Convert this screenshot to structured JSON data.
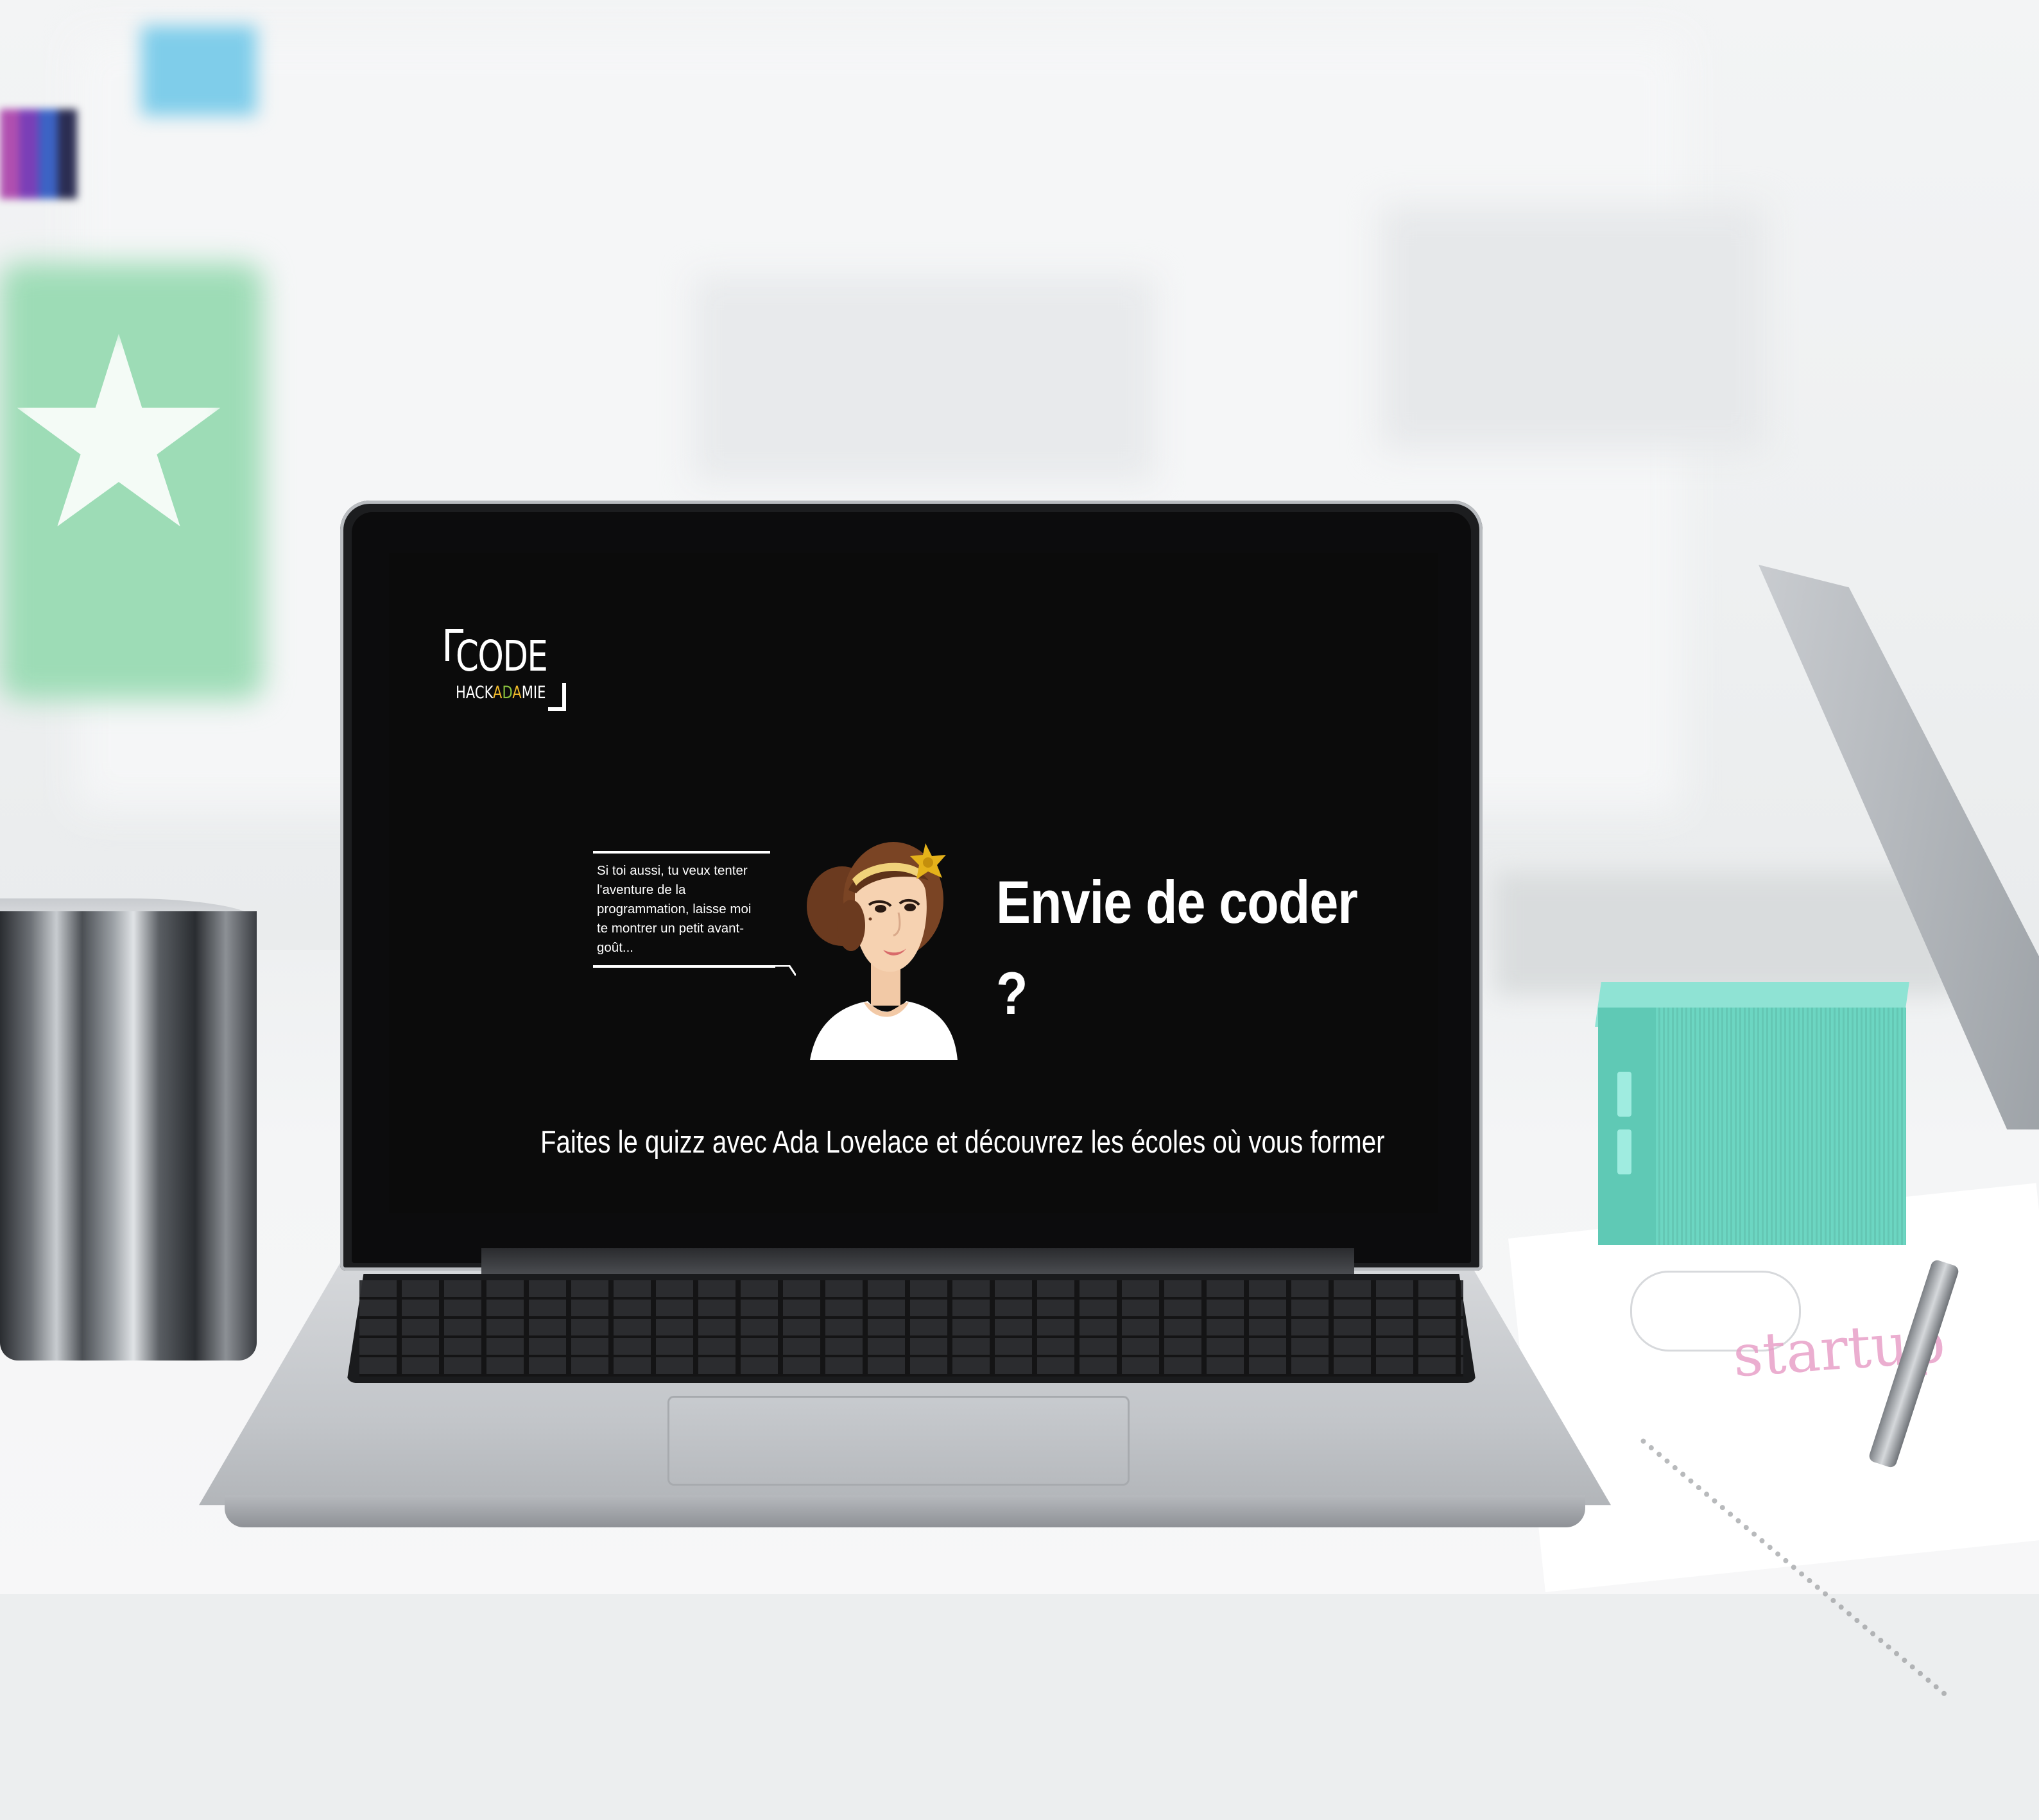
{
  "screen": {
    "logo": {
      "code": "CODE",
      "hack_parts": [
        {
          "text": "HACK",
          "color": "#ffffff"
        },
        {
          "text": "A",
          "color": "#f0b92a"
        },
        {
          "text": "D",
          "color": "#8bc53f"
        },
        {
          "text": "A",
          "color": "#f0b92a"
        },
        {
          "text": "MIE",
          "color": "#ffffff"
        }
      ]
    },
    "bubble_text": "Si toi aussi, tu veux tenter l'aventure de la programmation, laisse moi te montrer un petit avant-goût...",
    "headline": "Envie de coder",
    "headline_mark": "?",
    "subtitle": "Faites le quizz avec Ada Lovelace et découvrez les écoles où vous former"
  },
  "background": {
    "sketch_note": "startup"
  },
  "colors": {
    "screen_bg": "#0b0b0b",
    "text": "#ffffff",
    "accent_yellow": "#f0b92a",
    "accent_green": "#8bc53f",
    "speaker": "#6cd6c2"
  },
  "icons": [
    "ada-lovelace-avatar",
    "logo-bracket"
  ]
}
